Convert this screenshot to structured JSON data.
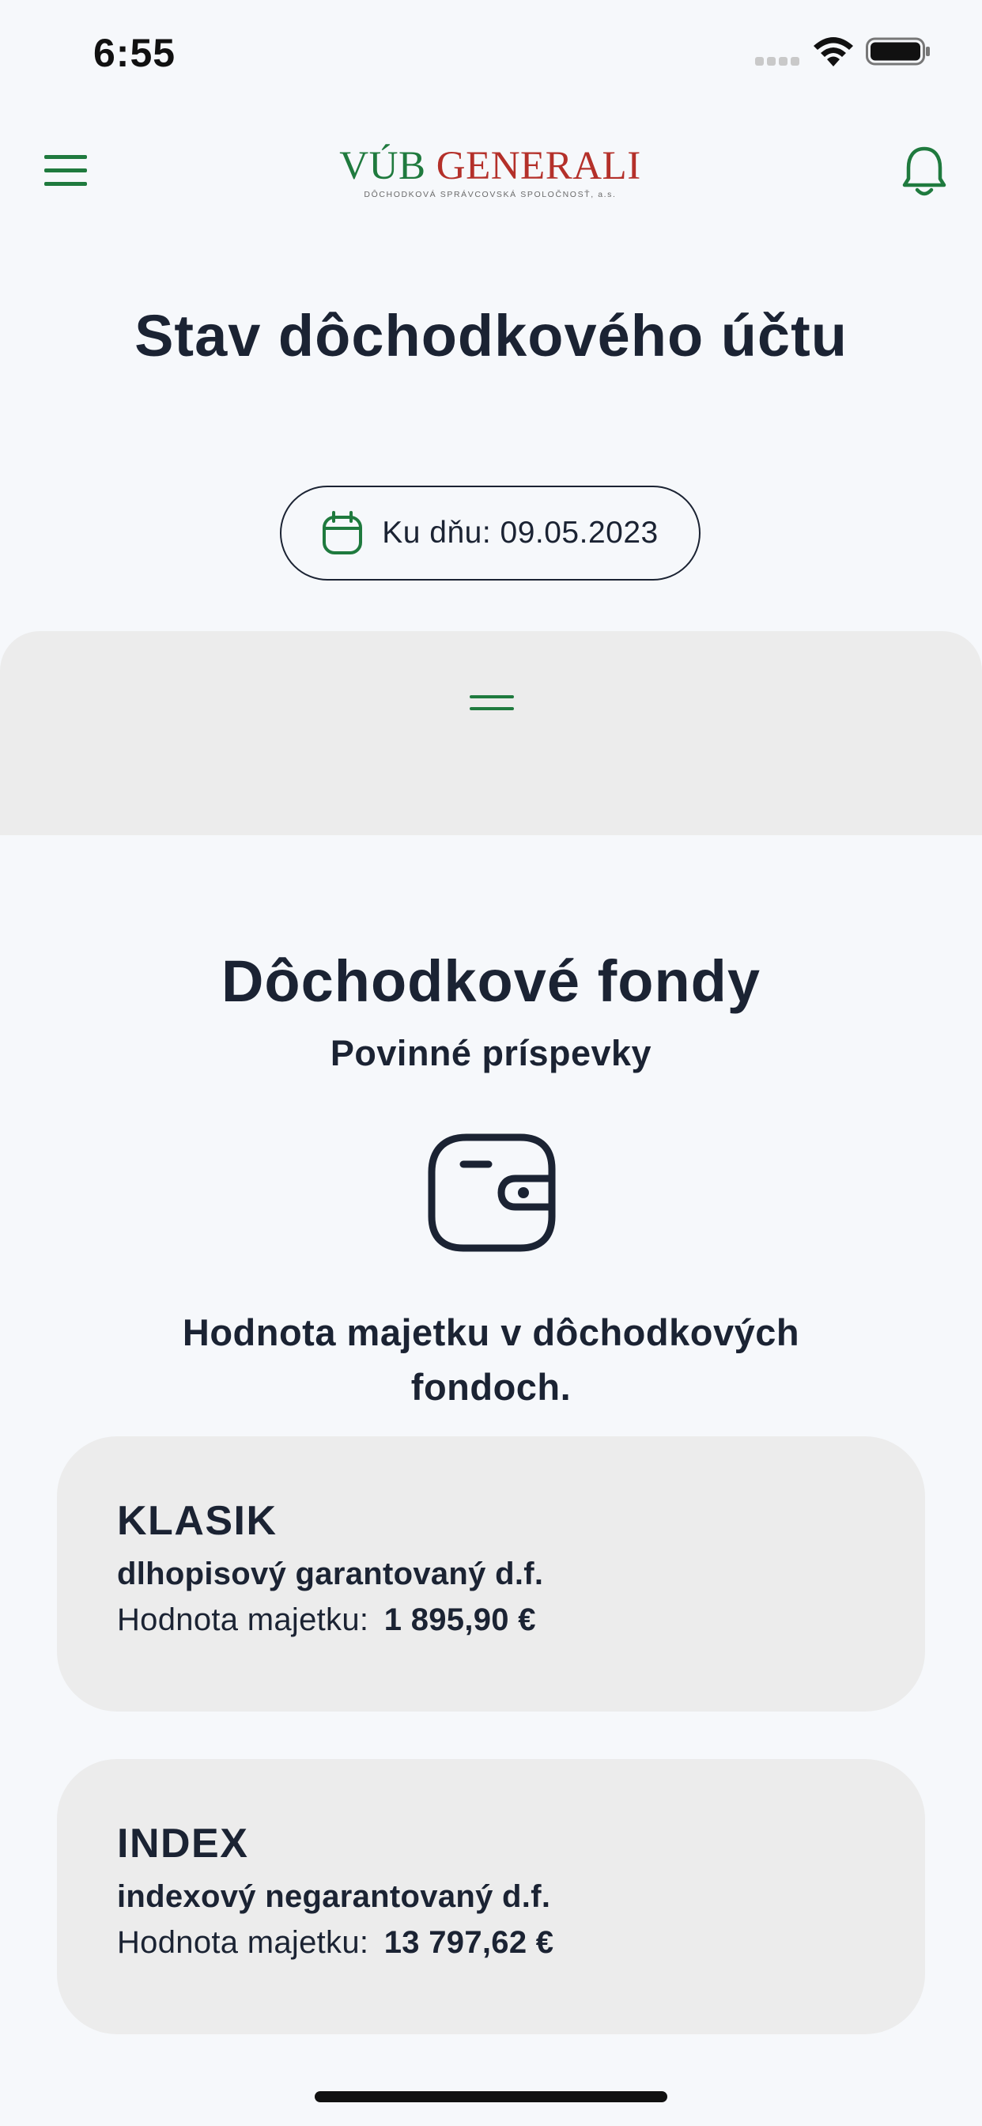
{
  "status_bar": {
    "time": "6:55"
  },
  "header": {
    "logo": {
      "brand_part1": "VÚB",
      "brand_part2": "GENERALI",
      "subtitle": "DÔCHODKOVÁ SPRÁVCOVSKÁ SPOLOČNOSŤ, a.s."
    },
    "icons": {
      "menu": "hamburger-menu-icon",
      "notifications": "bell-icon"
    }
  },
  "page": {
    "title": "Stav dôchodkového účtu",
    "date_label": "Ku dňu: 09.05.2023"
  },
  "section": {
    "title": "Dôchodkové fondy",
    "subtitle": "Povinné príspevky",
    "description": "Hodnota majetku v dôchodkových fondoch."
  },
  "funds": [
    {
      "name": "KLASIK",
      "type": "dlhopisový garantovaný d.f.",
      "value_label": "Hodnota majetku:",
      "value": "1 895,90 €"
    },
    {
      "name": "INDEX",
      "type": "indexový negarantovaný d.f.",
      "value_label": "Hodnota majetku:",
      "value": "13 797,62 €"
    }
  ],
  "colors": {
    "accent_green": "#1f7a3e",
    "brand_red": "#b4302a",
    "text_dark": "#1b2333",
    "background": "#f6f8fb",
    "card_background": "#ececec"
  }
}
